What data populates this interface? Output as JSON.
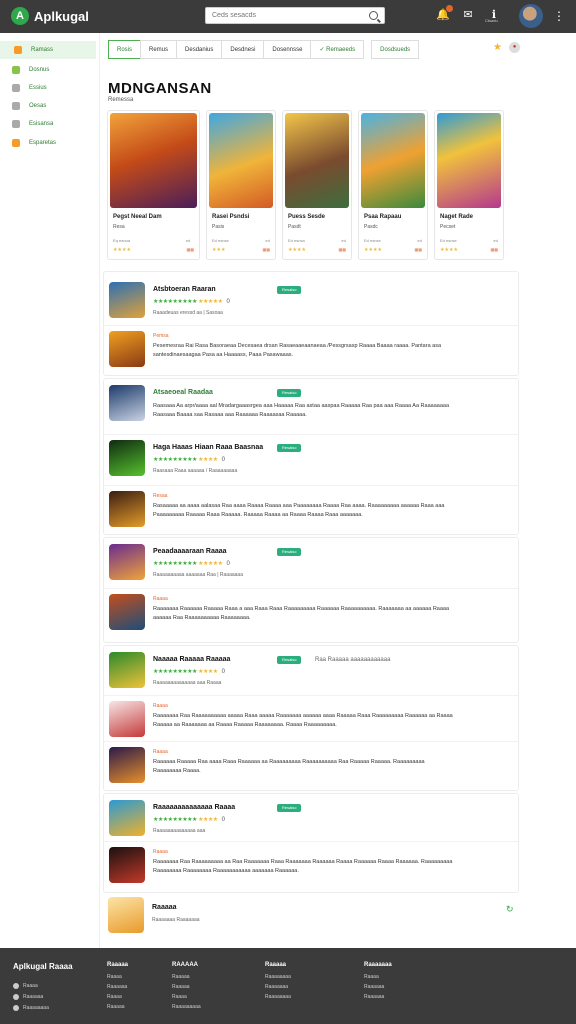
{
  "app": {
    "name": "Aplkugal",
    "logo_letter": "A"
  },
  "search": {
    "placeholder": "Ceds sesacds"
  },
  "top_icons": [
    {
      "name": "bell-icon",
      "glyph": "🔔",
      "label": ""
    },
    {
      "name": "mail-icon",
      "glyph": "✉",
      "label": ""
    },
    {
      "name": "info-icon",
      "glyph": "ℹ",
      "label": "Ctsadu"
    }
  ],
  "sidebar": {
    "items": [
      {
        "label": "Ramass",
        "icon": "home-icon",
        "color": "#f59c2a",
        "active": true
      },
      {
        "label": "Dosnus",
        "icon": "pen-icon",
        "color": "#8bc34a",
        "active": false
      },
      {
        "label": "Essius",
        "icon": "feather-icon",
        "color": "#aaa",
        "active": false
      },
      {
        "label": "Oesas",
        "icon": "clock-icon",
        "color": "#aaa",
        "active": false
      },
      {
        "label": "Esisansa",
        "icon": "star-icon",
        "color": "#aaa",
        "active": false
      },
      {
        "label": "Esparetas",
        "icon": "gift-icon",
        "color": "#f59c2a",
        "active": false
      }
    ]
  },
  "tabs": [
    {
      "label": "Rosis",
      "active": true,
      "green": false
    },
    {
      "label": "Remus",
      "active": false,
      "green": false
    },
    {
      "label": "Desdanius",
      "active": false,
      "green": false
    },
    {
      "label": "Desdnesi",
      "active": false,
      "green": false
    },
    {
      "label": "Dosennsse",
      "active": false,
      "green": false
    },
    {
      "label": "✓ Remaeeds",
      "active": false,
      "green": true
    },
    {
      "label": "Dosdsueds",
      "active": false,
      "green": true
    }
  ],
  "page": {
    "title": "MDNGANSAN",
    "subtitle": "Remessa"
  },
  "featured": [
    {
      "title": "Pegst Neeal Dam",
      "sub": "Resa",
      "meta_left": "Eq eanua",
      "meta_right": "ed",
      "rating": "★★★★",
      "badge": "▦▦",
      "art": "linear-gradient(160deg,#f2a33b,#c44b18 45%,#4a1e59)"
    },
    {
      "title": "Rasei Psndsi",
      "sub": "Pasis",
      "meta_left": "Ed esnse",
      "meta_right": "ed",
      "rating": "★★★",
      "badge": "▦▦",
      "art": "linear-gradient(160deg,#3fa7e3,#f0b43a 55%,#d35a25)"
    },
    {
      "title": "Puess Sesde",
      "sub": "Pasdt",
      "meta_left": "Ed esnsa",
      "meta_right": "ed",
      "rating": "★★★★",
      "badge": "▦▦",
      "art": "linear-gradient(160deg,#f3c64a,#7a4b2f 55%,#3d6e3e)"
    },
    {
      "title": "Psaa Rapaau",
      "sub": "Pasdc",
      "meta_left": "Ed esnse",
      "meta_right": "ed",
      "rating": "★★★★",
      "badge": "▦▦",
      "art": "linear-gradient(160deg,#4bb2e4,#f0a131 50%,#3a8a3d)"
    },
    {
      "title": "Naget Rade",
      "sub": "Pecset",
      "meta_left": "Ed esnse",
      "meta_right": "ed",
      "rating": "★★★★",
      "badge": "▦▦",
      "art": "linear-gradient(160deg,#2f9ad7,#f1c23c 40%,#b4388e)"
    }
  ],
  "groups": [
    {
      "entries": [
        {
          "kind": "rated",
          "title": "Atsbtoeran Raaran",
          "tag": "Resalso",
          "rating": "★★★★★★★★★",
          "yellow": "★★★★★",
          "score": "0",
          "meta": "Raaadeuas eressd aa  | Sasoaa",
          "art": "linear-gradient(160deg,#2d6fb5,#e0a23a)"
        },
        {
          "kind": "desc",
          "label": "Pemsa",
          "text": "Pesemesraa Rai Rasa Basoraeaa Decesaea drsan Rasaeaaeaanaeaa /Pessgrsasp Raaaa Baaaa raaaa. Pantara asa santesdinaesaagaa Pasa aa Haaaass, Paaa Pasawaaas.",
          "art": "linear-gradient(160deg,#f0a020,#8a3a14)"
        }
      ]
    },
    {
      "entries": [
        {
          "kind": "desc",
          "title": "Atsaeoeal Raadaa",
          "tag": "Resalso",
          "label": "",
          "text": "Raasaaa Aa arpr/aaaa aal Mradargaaasrgea aaa Haaaaa Raa astaa aaspaa Raaaaa Raa paa aaa Raaaa Aa Raaaaaaaa Raasaaa Baaaa saa Rasaaa aaa Raaaaaa Raaaasaa Raaaaa.",
          "art": "linear-gradient(160deg,#1c3a6a,#c9d3e3)"
        },
        {
          "kind": "rated",
          "title": "Haga Haaas Hiaan Raaa Baasnaa",
          "tag": "Resalso",
          "rating": "★★★★★★★★★",
          "yellow": "★★★★",
          "score": "0",
          "meta": "Raasaaa Raaa aaaaaa / Raaaaaaaaa",
          "art": "linear-gradient(160deg,#0e2b10,#58c12f)"
        },
        {
          "kind": "desc",
          "label": "Resaa",
          "text": "Rasaaaaa aa aaaa aalasaa Raa aaaa Raaaa Raaaa aaa Paaaaaaaa Raaaa Raa aaaa. Raaaaaaaaa aaaaaa Raaa aaa Paaaaaaaaa Raaaaa Raaa Raaaaa. Raaaaa Raaaa aa Raaaa Raaaa Raaa aaaaaaa.",
          "art": "linear-gradient(160deg,#3a1d12,#e59d2a)"
        }
      ]
    },
    {
      "entries": [
        {
          "kind": "rated",
          "title": "Peaadaaaaraan Raaaa",
          "tag": "Resalso",
          "rating": "★★★★★★★★★",
          "yellow": "★★★★★",
          "score": "0",
          "meta": "Raaaaaaaaaa aaaaaaa   Raa  | Raaaaaaa",
          "art": "linear-gradient(160deg,#6a2c8f,#f0a43a)"
        },
        {
          "kind": "desc",
          "label": "Raaaa",
          "text": "Raaaaaaa Raaaaaa Raaaaa Raaa a aaa Raaa Raaa Raaaaaaaaa Raaaaaa Raaaaaaaaaa. Raaaaaaa aa aaaaaa Raaaa aaaaaa Raa Raaaaaaaaaa Raaaaaaaa.",
          "art": "linear-gradient(160deg,#c34f1d,#1e4d7a)"
        }
      ]
    },
    {
      "entries": [
        {
          "kind": "rated",
          "title": "Naaaaa Raaaaa Raaaaa",
          "tag": "Resalso",
          "extra": "Raa Raaaaa aaaaaaaaaaaa",
          "rating": "★★★★★★★★★",
          "yellow": "★★★★",
          "score": "0",
          "meta": "Raaaaaaaaaaaaaa aaa Raaaa",
          "art": "linear-gradient(160deg,#2b8a2b,#f0c23a)"
        },
        {
          "kind": "desc",
          "label": "Raaaa",
          "text": "Raaaaaaa Raa Raaaaaaaaaa aaaaa Raaa aaaaa Raaaaaaa aaaaaa aaaa Raaaaa Raaa Raaaaaaaaa Raaaaaa aa Raaaa Raaaaa aa Raaaaaaa aa Raaaa Raaaaa Raaaaaaaa. Raaaa Raaaaaaaaa.",
          "art": "linear-gradient(160deg,#f7e5e5,#c43a3a)"
        },
        {
          "kind": "desc",
          "label": "Raaaa",
          "text": "Raaaaaa Raaaaa Raa aaaa Raaa Raaaaaa aa Raaaaaaaaa Raaaaaaaaaa Raa Raaaaa Raaaaa. Raaaaaaaaa Raaaaaaaa Raaaa.",
          "art": "linear-gradient(160deg,#2a1a4a,#e8902a)"
        }
      ]
    },
    {
      "entries": [
        {
          "kind": "rated",
          "title": "Raaaaaaaaaaaaaa Raaaa",
          "tag": "Resalso",
          "rating": "★★★★★★★★★",
          "yellow": "★★★★",
          "score": "0",
          "meta": "Raaaaaaaaaaaaaa aaa",
          "art": "linear-gradient(160deg,#2a9ad4,#f0b12a)"
        },
        {
          "kind": "desc",
          "label": "Raaaa",
          "text": "Raaaaaaa Raa Raaaaaaaaa aa Raa Raaaaaaa Raaa Raaaaaaa Raaaaaa Raaaa Raaaaaa Raaaa Raaaaaa. Raaaaaaaaa Raaaaaaaa Raaaaaaaa Raaaaaaaaaaa aaaaaaa Raaaaaa.",
          "art": "linear-gradient(160deg,#1a1010,#c33a2a)"
        }
      ]
    }
  ],
  "last": {
    "title": "Raaaaa",
    "meta": "Raaaaaaa Raaaaaaa",
    "art": "linear-gradient(160deg,#fce4a8,#e89a2a)"
  },
  "footer": {
    "brand": "Aplkugal Raaaa",
    "social": [
      "Raaaa",
      "Raaaaaa",
      "Raaaaaaaa"
    ],
    "columns": [
      {
        "heading": "Raaaaa",
        "items": [
          "Raaaa",
          "Raaaaaa",
          "Raaaa",
          "Raaaaa"
        ]
      },
      {
        "heading": "RAAAAA",
        "items": [
          "Raaaaa",
          "Raaaaa",
          "Raaaa",
          "Raaaaaaaaa"
        ]
      },
      {
        "heading": "Raaaaa",
        "items": [
          "Raaaaaaaa",
          "Raaaaaaa",
          "Raaaaaaaa"
        ]
      },
      {
        "heading": "Raaaaaaa",
        "items": [
          "Raaaa",
          "Raaaaaa",
          "Raaaaaa"
        ]
      }
    ]
  },
  "colors": {
    "accent": "#2ea84a",
    "topbar": "#3b3b3b",
    "tag": "#2bae7e",
    "orange": "#e8632a"
  }
}
